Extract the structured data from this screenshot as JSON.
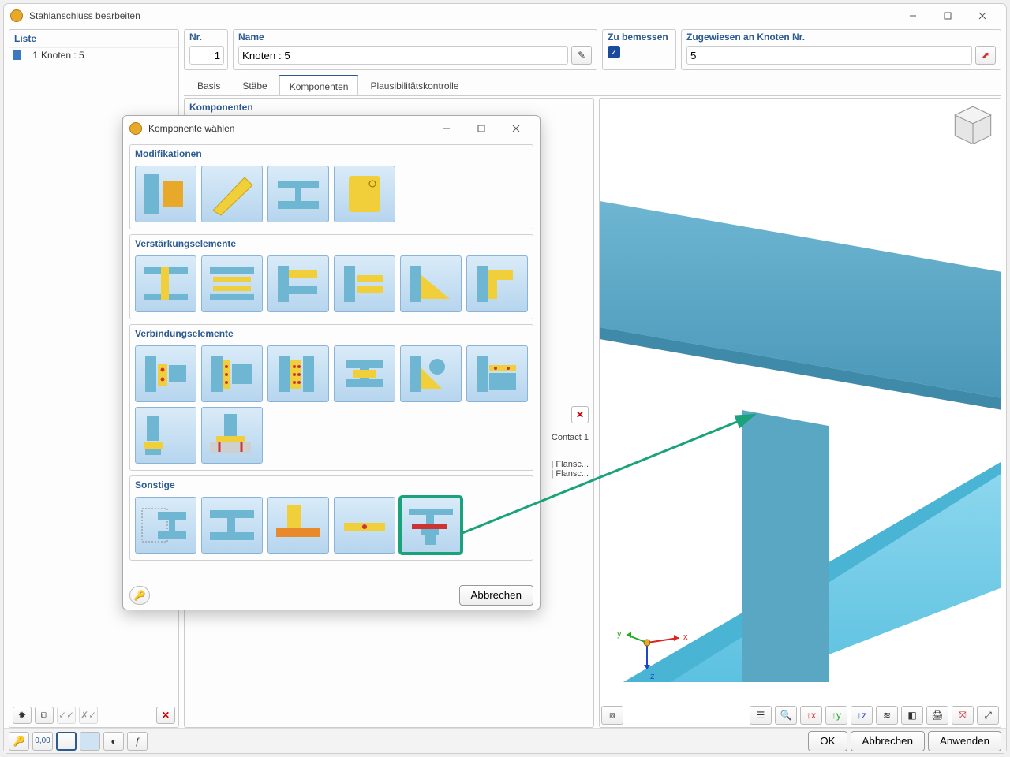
{
  "window": {
    "title": "Stahlanschluss bearbeiten"
  },
  "list": {
    "header": "Liste",
    "item_num": "1",
    "item_label": "Knoten : 5"
  },
  "fields": {
    "nr_label": "Nr.",
    "nr_value": "1",
    "name_label": "Name",
    "name_value": "Knoten : 5",
    "bemessen_label": "Zu bemessen",
    "node_label": "Zugewiesen an Knoten Nr.",
    "node_value": "5"
  },
  "tabs": {
    "t1": "Basis",
    "t2": "Stäbe",
    "t3": "Komponenten",
    "t4": "Plausibilitätskontrolle"
  },
  "comp_panel": {
    "title": "Komponenten",
    "contact": "Contact 1",
    "row1": "| Flansc...",
    "row2": "| Flansc..."
  },
  "modal": {
    "title": "Komponente wählen",
    "cat1": "Modifikationen",
    "cat2": "Verstärkungselemente",
    "cat3": "Verbindungselemente",
    "cat4": "Sonstige",
    "cancel": "Abbrechen"
  },
  "axes": {
    "x": "x",
    "y": "y",
    "z": "z"
  },
  "buttons": {
    "ok": "OK",
    "cancel": "Abbrechen",
    "apply": "Anwenden"
  },
  "icons": {
    "decimal": "0,00"
  }
}
